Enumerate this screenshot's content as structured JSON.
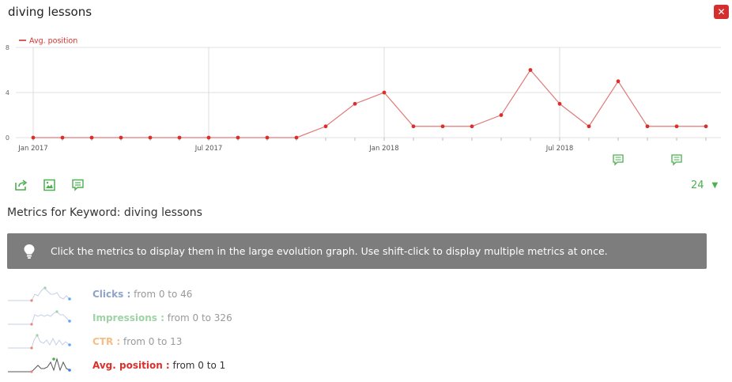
{
  "header": {
    "title": "diving lessons",
    "close_label": "✕"
  },
  "chart_data": {
    "type": "line",
    "series": [
      {
        "name": "Avg. position",
        "color": "#d9302c",
        "values": [
          0,
          0,
          0,
          0,
          0,
          0,
          0,
          0,
          0,
          0,
          1,
          3,
          4,
          1,
          1,
          1,
          2,
          6,
          3,
          1,
          5,
          1,
          1,
          1
        ]
      }
    ],
    "x_labels": [
      "Jan 2017",
      "Jul 2017",
      "Jan 2018",
      "Jul 2018"
    ],
    "y_ticks": [
      0,
      4,
      8
    ],
    "ylim": [
      0,
      8
    ],
    "grid": true,
    "legend_position": "top-left"
  },
  "toolbar": {
    "icons": [
      "export-icon",
      "image-icon",
      "annotation-icon"
    ]
  },
  "period": {
    "value": "24",
    "caret": "▼"
  },
  "metrics": {
    "heading": "Metrics for Keyword: diving lessons",
    "info": "Click the metrics to display them in the large evolution graph. Use shift-click to display multiple metrics at once.",
    "rows": [
      {
        "name": "Clicks :",
        "range": "from 0 to 46",
        "color": "#8fa3cc"
      },
      {
        "name": "Impressions :",
        "range": "from 0 to 326",
        "color": "#9dd3a5"
      },
      {
        "name": "CTR :",
        "range": "from 0 to 13",
        "color": "#f7bd83"
      },
      {
        "name": "Avg. position :",
        "range": "from 0 to 1",
        "color": "#d9302c"
      }
    ]
  }
}
